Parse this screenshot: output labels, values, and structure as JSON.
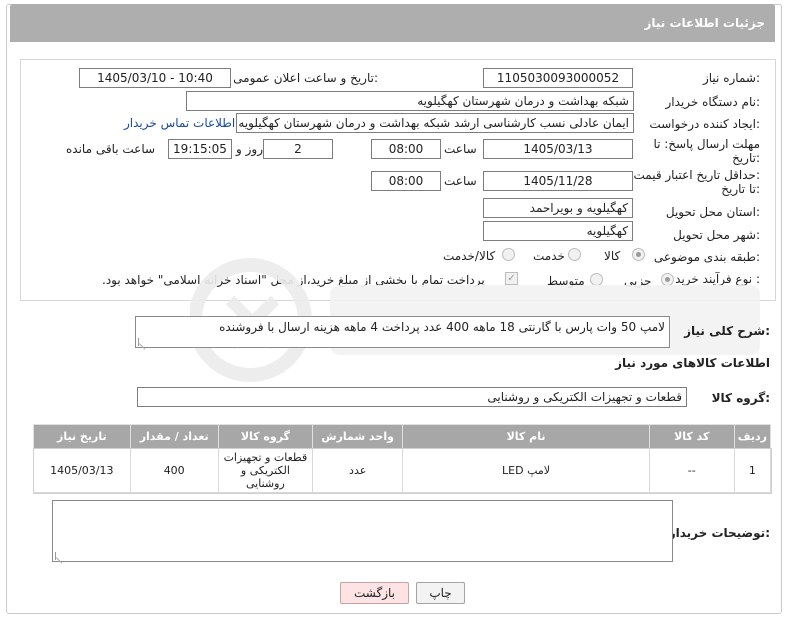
{
  "header": {
    "title": "جزئیات اطلاعات نیاز"
  },
  "form": {
    "need_number": {
      "label": "شماره نیاز:",
      "value": "1105030093000052"
    },
    "announce": {
      "label": "تاریخ و ساعت اعلان عمومی:",
      "value": "1405/03/10 - 10:40"
    },
    "buyer_org": {
      "label": "نام دستگاه خریدار:",
      "value": "شبکه بهداشت و درمان شهرستان کهگیلویه"
    },
    "creator": {
      "label": "ایجاد کننده درخواست:",
      "value": "ایمان عادلی نسب کارشناسی ارشد شبکه بهداشت و درمان شهرستان کهگیلویه",
      "contact_link": "اطلاعات تماس خریدار"
    },
    "reply_deadline": {
      "label_line1": "مهلت ارسال پاسخ: تا",
      "label_line2": "تاریخ:",
      "date": "1405/03/13",
      "time_label": "ساعت",
      "time": "08:00",
      "days": "2",
      "days_label": "روز و",
      "remaining": "19:15:05",
      "remaining_label": "ساعت باقی مانده"
    },
    "price_deadline": {
      "label_line1": "حداقل تاریخ اعتبار قیمت:",
      "label_line2": "تا تاریخ:",
      "date": "1405/11/28",
      "time_label": "ساعت",
      "time": "08:00"
    },
    "province": {
      "label": "استان محل تحویل:",
      "value": "کهگیلویه و بویراحمد"
    },
    "city": {
      "label": "شهر محل تحویل:",
      "value": "کهگیلویه"
    },
    "category": {
      "label": "طبقه بندی موضوعی:",
      "options": [
        "کالا",
        "خدمت",
        "کالا/خدمت"
      ],
      "selected": "کالا"
    },
    "process": {
      "label": "نوع فرآیند خرید :",
      "options": [
        "جزیی",
        "متوسط"
      ],
      "selected": "جزیی",
      "checkbox_text": "پرداخت تمام یا بخشی از مبلغ خرید،از محل \"اسناد خزانه اسلامی\" خواهد بود.",
      "checkbox_checked": true
    }
  },
  "description": {
    "label": "شرح کلی نیاز:",
    "value": "لامپ 50 وات پارس با گارنتی 18 ماهه 400 عدد پرداخت 4 ماهه هزینه ارسال با فروشنده"
  },
  "goods_section": {
    "title": "اطلاعات کالاهای مورد نیاز"
  },
  "goods_group": {
    "label": "گروه کالا:",
    "value": "قطعات و تجهیزات الکتریکی و روشنایی"
  },
  "table": {
    "headers": [
      "ردیف",
      "کد کالا",
      "نام کالا",
      "واحد شمارش",
      "گروه کالا",
      "تعداد / مقدار",
      "تاریخ نیاز"
    ],
    "rows": [
      [
        "1",
        "--",
        "لامپ LED",
        "عدد",
        "قطعات و تجهیزات الکتریکی و روشنایی",
        "400",
        "1405/03/13"
      ]
    ]
  },
  "buyer_notes": {
    "label": "توضیحات خریدار:",
    "value": ""
  },
  "buttons": {
    "print": "چاپ",
    "back": "بازگشت"
  },
  "colors": {
    "header_bg": "#aeaeae",
    "table_header_bg": "#a7a7a7",
    "back_button_bg": "#fde3e3",
    "link": "#1a4aa0"
  }
}
